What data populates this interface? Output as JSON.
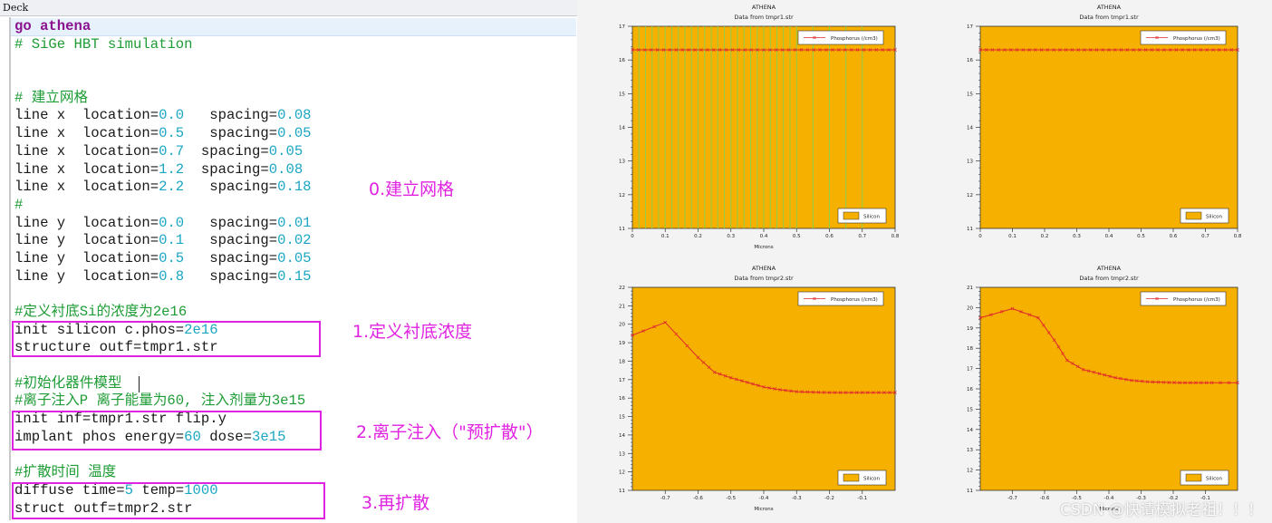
{
  "deck": {
    "title": "Deck",
    "lines": [
      {
        "kind": "kw",
        "text": "go athena"
      },
      {
        "kind": "c",
        "text": "# SiGe HBT simulation"
      },
      {
        "kind": "blank",
        "text": ""
      },
      {
        "kind": "blank",
        "text": ""
      },
      {
        "kind": "c",
        "text": "# 建立网格"
      },
      {
        "kind": "cmd",
        "parts": [
          {
            "t": "line x  location="
          },
          {
            "n": "0.0"
          },
          {
            "t": "   spacing="
          },
          {
            "n": "0.08"
          }
        ]
      },
      {
        "kind": "cmd",
        "parts": [
          {
            "t": "line x  location="
          },
          {
            "n": "0.5"
          },
          {
            "t": "   spacing="
          },
          {
            "n": "0.05"
          }
        ]
      },
      {
        "kind": "cmd",
        "parts": [
          {
            "t": "line x  location="
          },
          {
            "n": "0.7"
          },
          {
            "t": "  spacing="
          },
          {
            "n": "0.05"
          }
        ]
      },
      {
        "kind": "cmd",
        "parts": [
          {
            "t": "line x  location="
          },
          {
            "n": "1.2"
          },
          {
            "t": "  spacing="
          },
          {
            "n": "0.08"
          }
        ]
      },
      {
        "kind": "cmd",
        "parts": [
          {
            "t": "line x  location="
          },
          {
            "n": "2.2"
          },
          {
            "t": "   spacing="
          },
          {
            "n": "0.18"
          }
        ]
      },
      {
        "kind": "c",
        "text": "#"
      },
      {
        "kind": "cmd",
        "parts": [
          {
            "t": "line y  location="
          },
          {
            "n": "0.0"
          },
          {
            "t": "   spacing="
          },
          {
            "n": "0.01"
          }
        ]
      },
      {
        "kind": "cmd",
        "parts": [
          {
            "t": "line y  location="
          },
          {
            "n": "0.1"
          },
          {
            "t": "   spacing="
          },
          {
            "n": "0.02"
          }
        ]
      },
      {
        "kind": "cmd",
        "parts": [
          {
            "t": "line y  location="
          },
          {
            "n": "0.5"
          },
          {
            "t": "   spacing="
          },
          {
            "n": "0.05"
          }
        ]
      },
      {
        "kind": "cmd",
        "parts": [
          {
            "t": "line y  location="
          },
          {
            "n": "0.8"
          },
          {
            "t": "   spacing="
          },
          {
            "n": "0.15"
          }
        ]
      },
      {
        "kind": "blank",
        "text": ""
      },
      {
        "kind": "c",
        "text": "#定义衬底Si的浓度为2e16"
      },
      {
        "kind": "cmd",
        "parts": [
          {
            "t": "init silicon c.phos="
          },
          {
            "n": "2e16"
          }
        ]
      },
      {
        "kind": "cmd",
        "parts": [
          {
            "t": "structure outf=tmpr1.str"
          }
        ]
      },
      {
        "kind": "blank",
        "text": ""
      },
      {
        "kind": "c",
        "text": "#初始化器件模型 "
      },
      {
        "kind": "c",
        "text": "#离子注入P 离子能量为60, 注入剂量为3e15"
      },
      {
        "kind": "cmd",
        "parts": [
          {
            "t": "init inf=tmpr1.str flip.y"
          }
        ]
      },
      {
        "kind": "cmd",
        "parts": [
          {
            "t": "implant phos energy="
          },
          {
            "n": "60"
          },
          {
            "t": " dose="
          },
          {
            "n": "3e15"
          }
        ]
      },
      {
        "kind": "blank",
        "text": ""
      },
      {
        "kind": "c",
        "text": "#扩散时间 温度"
      },
      {
        "kind": "cmd",
        "parts": [
          {
            "t": "diffuse time="
          },
          {
            "n": "5"
          },
          {
            "t": " temp="
          },
          {
            "n": "1000"
          }
        ]
      },
      {
        "kind": "cmd",
        "parts": [
          {
            "t": "struct outf=tmpr2.str"
          }
        ]
      }
    ]
  },
  "annotations": {
    "a0": "0.建立网格",
    "a1": "1.定义衬底浓度",
    "a2": "2.离子注入（\"预扩散\"）",
    "a3": "3.再扩散"
  },
  "colors": {
    "plot_fill": "#f6b000",
    "mesh_line": "#8fce4a",
    "profile": "#e0282d",
    "annotation": "#e023e0"
  },
  "plots": [
    {
      "title": "ATHENA",
      "subtitle": "Data from tmpr1.str",
      "xlabel": "Microns",
      "legend_series": "Phosphorus (/cm3)",
      "legend_region": "Silicon",
      "mesh": true,
      "x_range": [
        0,
        0.8
      ],
      "x_ticks": [
        "0",
        "0.1",
        "0.2",
        "0.3",
        "0.4",
        "0.5",
        "0.6",
        "0.7",
        "0.8"
      ],
      "y_range": [
        11,
        17
      ],
      "y_ticks": [
        "11",
        "12",
        "13",
        "14",
        "15",
        "16",
        "17"
      ],
      "chart_data": {
        "type": "line",
        "series": [
          {
            "name": "Phosphorus (/cm3)",
            "x": [
              0,
              0.8
            ],
            "y": [
              16.3,
              16.3
            ]
          }
        ]
      }
    },
    {
      "title": "ATHENA",
      "subtitle": "Data from tmpr1.str",
      "xlabel": "",
      "legend_series": "Phosphorus (/cm3)",
      "legend_region": "Silicon",
      "mesh": false,
      "x_range": [
        0,
        0.8
      ],
      "x_ticks": [
        "0",
        "0.1",
        "0.2",
        "0.3",
        "0.4",
        "0.5",
        "0.6",
        "0.7",
        "0.8"
      ],
      "y_range": [
        11,
        17
      ],
      "y_ticks": [
        "11",
        "12",
        "13",
        "14",
        "15",
        "16",
        "17"
      ],
      "chart_data": {
        "type": "line",
        "series": [
          {
            "name": "Phosphorus (/cm3)",
            "x": [
              0,
              0.8
            ],
            "y": [
              16.3,
              16.3
            ]
          }
        ]
      }
    },
    {
      "title": "ATHENA",
      "subtitle": "Data from tmpr2.str",
      "xlabel": "Microns",
      "legend_series": "Phosphorus (/cm3)",
      "legend_region": "Silicon",
      "mesh": false,
      "x_range": [
        -0.8,
        0
      ],
      "x_ticks": [
        "-0.7",
        "-0.6",
        "-0.5",
        "-0.4",
        "-0.3",
        "-0.2",
        "-0.1"
      ],
      "y_range": [
        11,
        22
      ],
      "y_ticks": [
        "11",
        "12",
        "13",
        "14",
        "15",
        "16",
        "17",
        "18",
        "19",
        "20",
        "21",
        "22"
      ],
      "chart_data": {
        "type": "line",
        "series": [
          {
            "name": "Phosphorus (/cm3)",
            "x": [
              -0.8,
              -0.7,
              -0.6,
              -0.55,
              -0.5,
              -0.45,
              -0.4,
              -0.35,
              -0.3,
              -0.25,
              -0.2,
              -0.15,
              -0.1,
              -0.05,
              0
            ],
            "y": [
              19.4,
              20.1,
              18.2,
              17.4,
              17.1,
              16.85,
              16.6,
              16.45,
              16.35,
              16.32,
              16.3,
              16.3,
              16.3,
              16.3,
              16.3
            ]
          }
        ]
      }
    },
    {
      "title": "ATHENA",
      "subtitle": "Data from tmpr2.str",
      "xlabel": "Microns",
      "legend_series": "Phosphorus (/cm3)",
      "legend_region": "Silicon",
      "mesh": false,
      "x_range": [
        -0.8,
        0
      ],
      "x_ticks": [
        "-0.7",
        "-0.6",
        "-0.5",
        "-0.4",
        "-0.3",
        "-0.2",
        "-0.1"
      ],
      "y_range": [
        11,
        21
      ],
      "y_ticks": [
        "11",
        "12",
        "13",
        "14",
        "15",
        "16",
        "17",
        "18",
        "19",
        "20",
        "21"
      ],
      "chart_data": {
        "type": "line",
        "series": [
          {
            "name": "Phosphorus (/cm3)",
            "x": [
              -0.8,
              -0.7,
              -0.62,
              -0.57,
              -0.53,
              -0.48,
              -0.43,
              -0.38,
              -0.33,
              -0.28,
              -0.23,
              -0.18,
              -0.13,
              -0.08,
              0
            ],
            "y": [
              19.5,
              19.95,
              19.5,
              18.4,
              17.4,
              16.95,
              16.75,
              16.55,
              16.42,
              16.35,
              16.32,
              16.3,
              16.3,
              16.3,
              16.3
            ]
          }
        ]
      }
    }
  ],
  "watermark": "CSDN @快请模拟老祖！！！"
}
